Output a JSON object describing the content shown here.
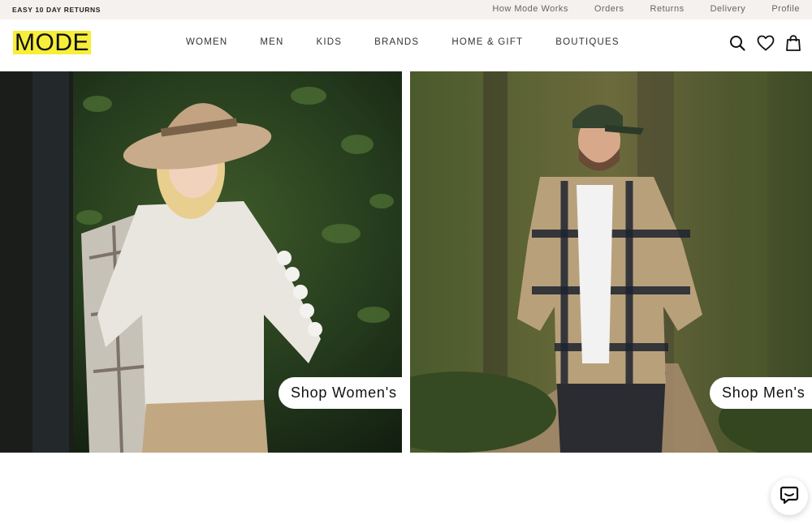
{
  "topbar": {
    "promo": "EASY 10 DAY RETURNS",
    "links": [
      "How Mode Works",
      "Orders",
      "Returns",
      "Delivery",
      "Profile"
    ]
  },
  "header": {
    "logo": "MODE",
    "logo_bg": "#f7ee3a",
    "nav": [
      "WOMEN",
      "MEN",
      "KIDS",
      "BRANDS",
      "HOME & GIFT",
      "BOUTIQUES"
    ],
    "icons": [
      "search-icon",
      "heart-icon",
      "bag-icon"
    ]
  },
  "hero": {
    "women_button": "Shop Women's",
    "men_button": "Shop Men's"
  },
  "chat": {
    "icon": "chat-icon"
  }
}
